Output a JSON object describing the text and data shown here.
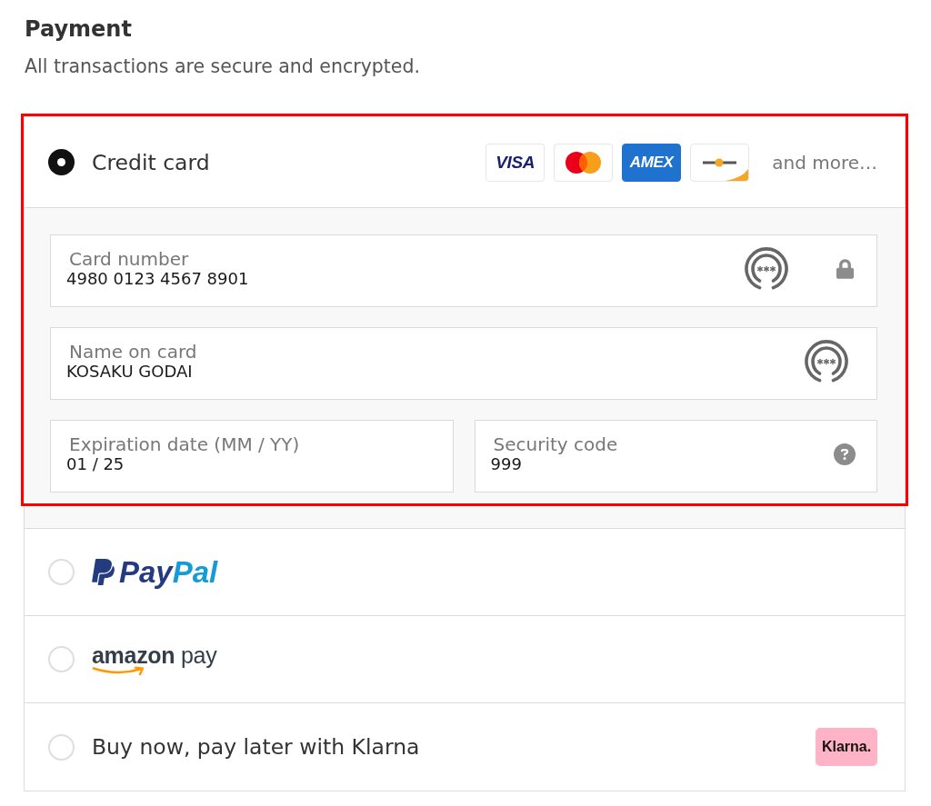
{
  "title": "Payment",
  "subtitle": "All transactions are secure and encrypted.",
  "options": [
    {
      "kind": "card",
      "label": "Credit card",
      "selected": true,
      "highlighted": true,
      "brands": [
        {
          "kind": "visa",
          "label": "VISA"
        },
        {
          "kind": "mastercard"
        },
        {
          "kind": "amex",
          "label": "AMEX"
        },
        {
          "kind": "generic"
        }
      ],
      "more": "and more…",
      "field_rows": [
        [
          {
            "kind": "card_number",
            "label": "Card number",
            "value": "4980 0123 4567 8901"
          }
        ],
        [
          {
            "kind": "name",
            "label": "Name on card",
            "value": "KOSAKU GODAI"
          }
        ],
        [
          {
            "kind": "expiry",
            "label": "Expiration date (MM / YY)",
            "value": "01 / 25"
          },
          {
            "kind": "security_code",
            "label": "Security code",
            "value": "999"
          }
        ]
      ]
    },
    {
      "kind": "paypal",
      "selected": false,
      "highlighted": false,
      "logo_parts": [
        "Pay",
        "Pal"
      ]
    },
    {
      "kind": "amazon_pay",
      "selected": false,
      "highlighted": false,
      "logo_parts": [
        "amazon",
        "pay"
      ]
    },
    {
      "kind": "klarna",
      "label": "Buy now, pay later with Klarna",
      "selected": false,
      "highlighted": false,
      "badge": "Klarna."
    }
  ]
}
